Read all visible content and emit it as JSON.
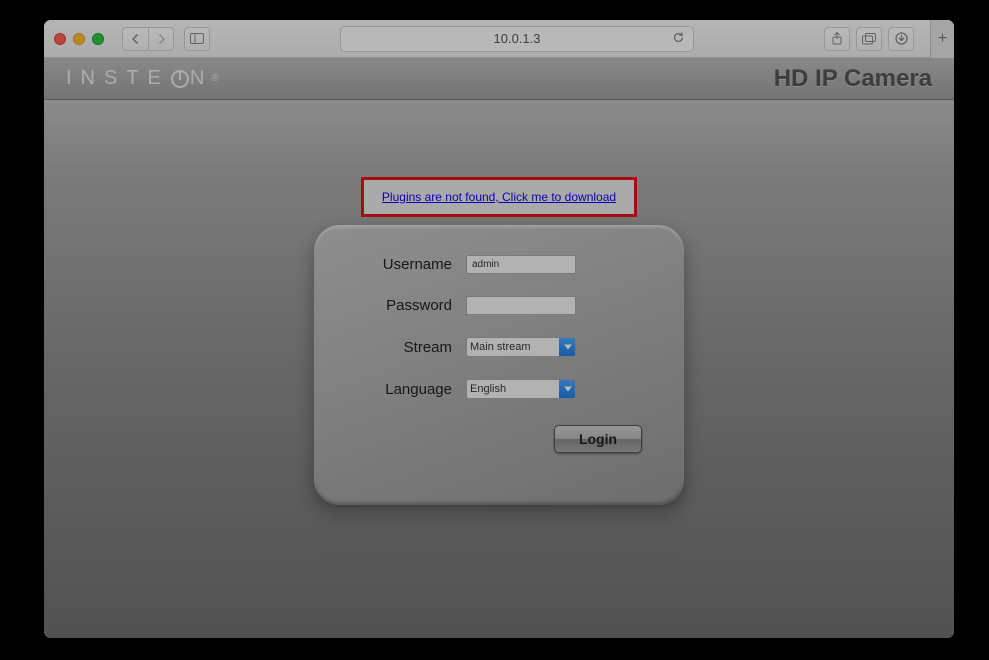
{
  "browser": {
    "address": "10.0.1.3"
  },
  "brand": {
    "name_left": "INSTE",
    "name_right": "N",
    "registered": "®",
    "title": "HD IP Camera"
  },
  "notice": {
    "text": "Plugins are not found, Click me to download"
  },
  "form": {
    "username_label": "Username",
    "username_value": "admin",
    "password_label": "Password",
    "password_value": "",
    "stream_label": "Stream",
    "stream_value": "Main stream",
    "language_label": "Language",
    "language_value": "English",
    "login_label": "Login"
  }
}
